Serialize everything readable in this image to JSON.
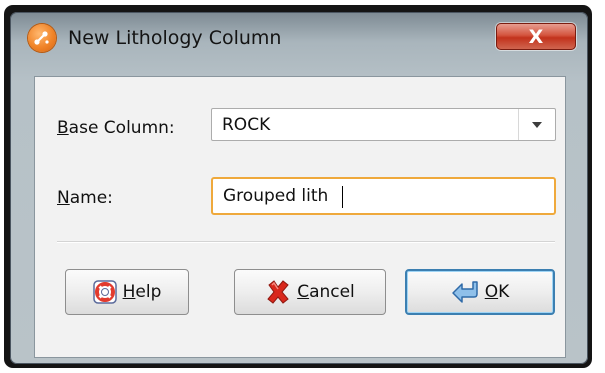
{
  "window": {
    "title": "New Lithology Column",
    "close_glyph": "X"
  },
  "form": {
    "base_column": {
      "label_accel": "B",
      "label_rest": "ase Column:",
      "value": "ROCK"
    },
    "name": {
      "label_accel": "N",
      "label_rest": "ame:",
      "value": "Grouped lith"
    }
  },
  "buttons": {
    "help": {
      "accel": "H",
      "rest": "elp",
      "icon": "lifebuoy-icon"
    },
    "cancel": {
      "accel": "C",
      "rest": "ancel",
      "icon": "red-x-icon"
    },
    "ok": {
      "accel": "O",
      "rest": "K",
      "icon": "enter-arrow-icon"
    }
  },
  "colors": {
    "focus_border": "#efa93c",
    "close_button": "#c2321c",
    "app_icon": "#f08428"
  }
}
